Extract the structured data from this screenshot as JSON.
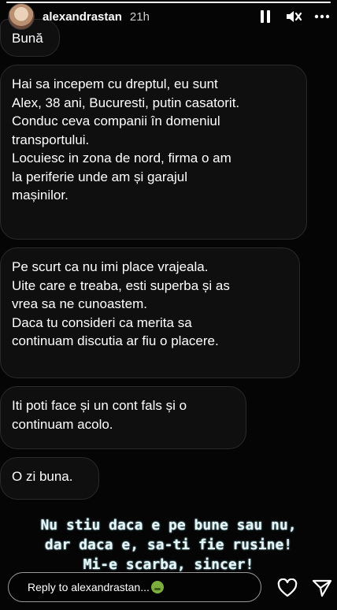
{
  "header": {
    "username": "alexandrastan",
    "time": "21h",
    "icons": [
      "pause-icon",
      "mute-icon",
      "more-icon"
    ]
  },
  "progress": 1.0,
  "messages": [
    {
      "lines": [
        "Bună"
      ]
    },
    {
      "lines": [
        "Hai sa incepem cu dreptul, eu sunt",
        "Alex, 38 ani, Bucuresti, putin casatorit.",
        "Conduc ceva companii în domeniul",
        "transportului.",
        "Locuiesc in zona de nord,  firma o am",
        "la periferie unde am și garajul",
        "mașinilor."
      ]
    },
    {
      "lines": [
        "Pe scurt ca nu imi place vrajeala.",
        "Uite care e treaba,  esti superba și as",
        "vrea sa ne cunoastem.",
        "Daca tu consideri ca merita sa",
        "continuam discutia ar fiu o placere."
      ]
    },
    {
      "lines": [
        "Iti poti face și un cont fals și o",
        "continuam acolo."
      ]
    },
    {
      "lines": [
        "O zi buna."
      ]
    }
  ],
  "overlay_text": [
    "Nu stiu daca e pe bune sau nu,",
    "dar daca e, sa-ti fie rusine!",
    "Mi-e scarba, sincer!"
  ],
  "footer": {
    "reply_placeholder": "Reply to alexandrastan...",
    "icons": [
      "heart-icon",
      "send-icon"
    ]
  },
  "colors": {
    "background": "#000000",
    "bubble": "#0f0f10",
    "bubble_border": "#2a2a2e",
    "overlay_text": "#e8f6f8"
  }
}
